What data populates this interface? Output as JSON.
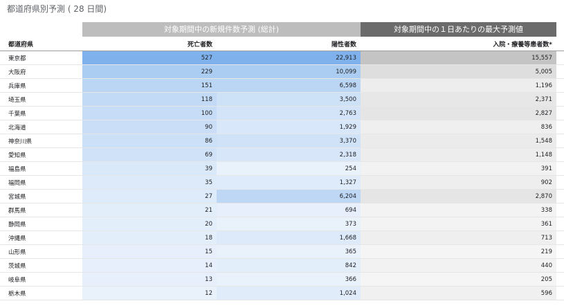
{
  "title": "都道府県別予測 ( 28 日間)",
  "headers": {
    "group_new": "対象期間中の新規件数予測 (総計)",
    "group_max": "対象期間中の１日あたりの最大予測値",
    "prefecture": "都道府県",
    "deaths": "死亡者数",
    "positives": "陽性者数",
    "hospitalized": "入院・療養等患者数*"
  },
  "colors": {
    "group_new_bg": "#bdbdbd",
    "group_max_bg": "#6b6b6b",
    "blue_scale_max": "#7fb2ec",
    "gray_scale_max": "#c4c4c4"
  },
  "rows": [
    {
      "prefecture": "東京都",
      "deaths": "527",
      "positives": "22,913",
      "hospitalized": "15,557",
      "d_level": 1.0,
      "p_level": 1.0,
      "h_level": 1.0
    },
    {
      "prefecture": "大阪府",
      "deaths": "229",
      "positives": "10,099",
      "hospitalized": "5,005",
      "d_level": 0.45,
      "p_level": 0.45,
      "h_level": 0.32
    },
    {
      "prefecture": "兵庫県",
      "deaths": "151",
      "positives": "6,598",
      "hospitalized": "1,196",
      "d_level": 0.3,
      "p_level": 0.3,
      "h_level": 0.08
    },
    {
      "prefecture": "埼玉県",
      "deaths": "118",
      "positives": "3,500",
      "hospitalized": "2,371",
      "d_level": 0.24,
      "p_level": 0.16,
      "h_level": 0.15
    },
    {
      "prefecture": "千葉県",
      "deaths": "100",
      "positives": "2,763",
      "hospitalized": "2,827",
      "d_level": 0.2,
      "p_level": 0.12,
      "h_level": 0.18
    },
    {
      "prefecture": "北海道",
      "deaths": "90",
      "positives": "1,929",
      "hospitalized": "836",
      "d_level": 0.18,
      "p_level": 0.09,
      "h_level": 0.05
    },
    {
      "prefecture": "神奈川県",
      "deaths": "86",
      "positives": "3,370",
      "hospitalized": "1,548",
      "d_level": 0.17,
      "p_level": 0.15,
      "h_level": 0.1
    },
    {
      "prefecture": "愛知県",
      "deaths": "69",
      "positives": "2,318",
      "hospitalized": "1,148",
      "d_level": 0.14,
      "p_level": 0.1,
      "h_level": 0.07
    },
    {
      "prefecture": "福島県",
      "deaths": "39",
      "positives": "254",
      "hospitalized": "391",
      "d_level": 0.08,
      "p_level": 0.02,
      "h_level": 0.03
    },
    {
      "prefecture": "福岡県",
      "deaths": "35",
      "positives": "1,327",
      "hospitalized": "902",
      "d_level": 0.07,
      "p_level": 0.06,
      "h_level": 0.06
    },
    {
      "prefecture": "宮城県",
      "deaths": "27",
      "positives": "6,204",
      "hospitalized": "2,870",
      "d_level": 0.06,
      "p_level": 0.28,
      "h_level": 0.18
    },
    {
      "prefecture": "群馬県",
      "deaths": "21",
      "positives": "694",
      "hospitalized": "338",
      "d_level": 0.04,
      "p_level": 0.03,
      "h_level": 0.02
    },
    {
      "prefecture": "静岡県",
      "deaths": "20",
      "positives": "373",
      "hospitalized": "361",
      "d_level": 0.04,
      "p_level": 0.02,
      "h_level": 0.02
    },
    {
      "prefecture": "沖縄県",
      "deaths": "18",
      "positives": "1,668",
      "hospitalized": "713",
      "d_level": 0.04,
      "p_level": 0.07,
      "h_level": 0.05
    },
    {
      "prefecture": "山形県",
      "deaths": "15",
      "positives": "365",
      "hospitalized": "219",
      "d_level": 0.03,
      "p_level": 0.02,
      "h_level": 0.01
    },
    {
      "prefecture": "茨城県",
      "deaths": "14",
      "positives": "842",
      "hospitalized": "440",
      "d_level": 0.03,
      "p_level": 0.04,
      "h_level": 0.03
    },
    {
      "prefecture": "岐阜県",
      "deaths": "13",
      "positives": "366",
      "hospitalized": "205",
      "d_level": 0.03,
      "p_level": 0.02,
      "h_level": 0.01
    },
    {
      "prefecture": "栃木県",
      "deaths": "12",
      "positives": "1,024",
      "hospitalized": "596",
      "d_level": 0.02,
      "p_level": 0.05,
      "h_level": 0.04
    }
  ]
}
